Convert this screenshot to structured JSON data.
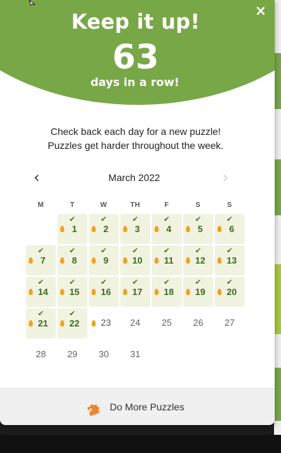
{
  "popup": {
    "title": "Keep it up!",
    "streak_count": "63",
    "streak_label": "days in a row!",
    "close_label": "×",
    "info_lines": [
      "Check back each day for a new puzzle!",
      "Puzzles get harder throughout the week."
    ]
  },
  "calendar": {
    "month": "March 2022",
    "prev_label": "‹",
    "next_label": "›",
    "weekdays": [
      "M",
      "T",
      "W",
      "TH",
      "F",
      "S",
      "S"
    ],
    "leading_blanks": 1,
    "days": [
      {
        "day": "1",
        "status": "solved"
      },
      {
        "day": "2",
        "status": "solved"
      },
      {
        "day": "3",
        "status": "solved"
      },
      {
        "day": "4",
        "status": "solved"
      },
      {
        "day": "5",
        "status": "solved"
      },
      {
        "day": "6",
        "status": "solved"
      },
      {
        "day": "7",
        "status": "solved"
      },
      {
        "day": "8",
        "status": "solved"
      },
      {
        "day": "9",
        "status": "solved"
      },
      {
        "day": "10",
        "status": "solved"
      },
      {
        "day": "11",
        "status": "solved"
      },
      {
        "day": "12",
        "status": "solved"
      },
      {
        "day": "13",
        "status": "solved"
      },
      {
        "day": "14",
        "status": "solved"
      },
      {
        "day": "15",
        "status": "solved"
      },
      {
        "day": "16",
        "status": "solved"
      },
      {
        "day": "17",
        "status": "solved"
      },
      {
        "day": "18",
        "status": "solved"
      },
      {
        "day": "19",
        "status": "solved"
      },
      {
        "day": "20",
        "status": "solved"
      },
      {
        "day": "21",
        "status": "solved"
      },
      {
        "day": "22",
        "status": "solved"
      },
      {
        "day": "23",
        "status": "open"
      },
      {
        "day": "24",
        "status": "future"
      },
      {
        "day": "25",
        "status": "future"
      },
      {
        "day": "26",
        "status": "future"
      },
      {
        "day": "27",
        "status": "future"
      },
      {
        "day": "28",
        "status": "future"
      },
      {
        "day": "29",
        "status": "future"
      },
      {
        "day": "30",
        "status": "future"
      },
      {
        "day": "31",
        "status": "future"
      }
    ]
  },
  "footer": {
    "button_label": "Do More Puzzles",
    "icon": "puzzle-piece-icon"
  },
  "colors": {
    "header_green": "#78a748",
    "solved_bg": "#f1f3e1",
    "day_text_green": "#3e6a20",
    "flame": "#f0a21f",
    "puzzle_icon": "#e8872f",
    "side_stripe_green": "#78a748",
    "side_stripe_lime": "#a8c83a"
  }
}
